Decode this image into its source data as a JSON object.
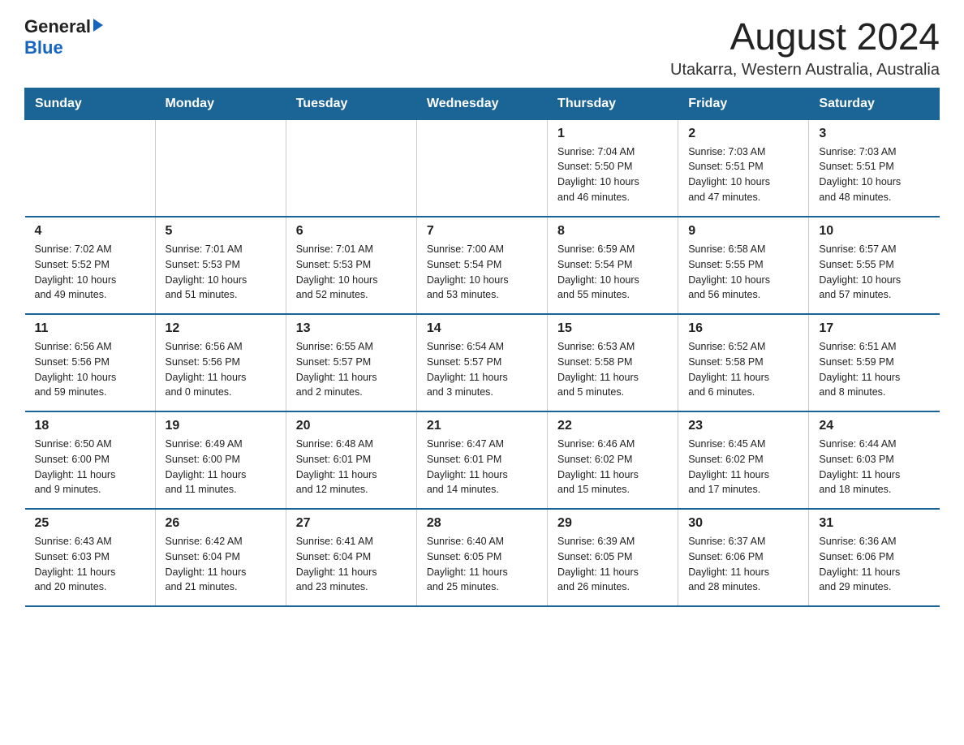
{
  "logo": {
    "general": "General",
    "blue": "Blue"
  },
  "title": "August 2024",
  "subtitle": "Utakarra, Western Australia, Australia",
  "days_of_week": [
    "Sunday",
    "Monday",
    "Tuesday",
    "Wednesday",
    "Thursday",
    "Friday",
    "Saturday"
  ],
  "weeks": [
    {
      "days": [
        {
          "number": "",
          "info": ""
        },
        {
          "number": "",
          "info": ""
        },
        {
          "number": "",
          "info": ""
        },
        {
          "number": "",
          "info": ""
        },
        {
          "number": "1",
          "info": "Sunrise: 7:04 AM\nSunset: 5:50 PM\nDaylight: 10 hours\nand 46 minutes."
        },
        {
          "number": "2",
          "info": "Sunrise: 7:03 AM\nSunset: 5:51 PM\nDaylight: 10 hours\nand 47 minutes."
        },
        {
          "number": "3",
          "info": "Sunrise: 7:03 AM\nSunset: 5:51 PM\nDaylight: 10 hours\nand 48 minutes."
        }
      ]
    },
    {
      "days": [
        {
          "number": "4",
          "info": "Sunrise: 7:02 AM\nSunset: 5:52 PM\nDaylight: 10 hours\nand 49 minutes."
        },
        {
          "number": "5",
          "info": "Sunrise: 7:01 AM\nSunset: 5:53 PM\nDaylight: 10 hours\nand 51 minutes."
        },
        {
          "number": "6",
          "info": "Sunrise: 7:01 AM\nSunset: 5:53 PM\nDaylight: 10 hours\nand 52 minutes."
        },
        {
          "number": "7",
          "info": "Sunrise: 7:00 AM\nSunset: 5:54 PM\nDaylight: 10 hours\nand 53 minutes."
        },
        {
          "number": "8",
          "info": "Sunrise: 6:59 AM\nSunset: 5:54 PM\nDaylight: 10 hours\nand 55 minutes."
        },
        {
          "number": "9",
          "info": "Sunrise: 6:58 AM\nSunset: 5:55 PM\nDaylight: 10 hours\nand 56 minutes."
        },
        {
          "number": "10",
          "info": "Sunrise: 6:57 AM\nSunset: 5:55 PM\nDaylight: 10 hours\nand 57 minutes."
        }
      ]
    },
    {
      "days": [
        {
          "number": "11",
          "info": "Sunrise: 6:56 AM\nSunset: 5:56 PM\nDaylight: 10 hours\nand 59 minutes."
        },
        {
          "number": "12",
          "info": "Sunrise: 6:56 AM\nSunset: 5:56 PM\nDaylight: 11 hours\nand 0 minutes."
        },
        {
          "number": "13",
          "info": "Sunrise: 6:55 AM\nSunset: 5:57 PM\nDaylight: 11 hours\nand 2 minutes."
        },
        {
          "number": "14",
          "info": "Sunrise: 6:54 AM\nSunset: 5:57 PM\nDaylight: 11 hours\nand 3 minutes."
        },
        {
          "number": "15",
          "info": "Sunrise: 6:53 AM\nSunset: 5:58 PM\nDaylight: 11 hours\nand 5 minutes."
        },
        {
          "number": "16",
          "info": "Sunrise: 6:52 AM\nSunset: 5:58 PM\nDaylight: 11 hours\nand 6 minutes."
        },
        {
          "number": "17",
          "info": "Sunrise: 6:51 AM\nSunset: 5:59 PM\nDaylight: 11 hours\nand 8 minutes."
        }
      ]
    },
    {
      "days": [
        {
          "number": "18",
          "info": "Sunrise: 6:50 AM\nSunset: 6:00 PM\nDaylight: 11 hours\nand 9 minutes."
        },
        {
          "number": "19",
          "info": "Sunrise: 6:49 AM\nSunset: 6:00 PM\nDaylight: 11 hours\nand 11 minutes."
        },
        {
          "number": "20",
          "info": "Sunrise: 6:48 AM\nSunset: 6:01 PM\nDaylight: 11 hours\nand 12 minutes."
        },
        {
          "number": "21",
          "info": "Sunrise: 6:47 AM\nSunset: 6:01 PM\nDaylight: 11 hours\nand 14 minutes."
        },
        {
          "number": "22",
          "info": "Sunrise: 6:46 AM\nSunset: 6:02 PM\nDaylight: 11 hours\nand 15 minutes."
        },
        {
          "number": "23",
          "info": "Sunrise: 6:45 AM\nSunset: 6:02 PM\nDaylight: 11 hours\nand 17 minutes."
        },
        {
          "number": "24",
          "info": "Sunrise: 6:44 AM\nSunset: 6:03 PM\nDaylight: 11 hours\nand 18 minutes."
        }
      ]
    },
    {
      "days": [
        {
          "number": "25",
          "info": "Sunrise: 6:43 AM\nSunset: 6:03 PM\nDaylight: 11 hours\nand 20 minutes."
        },
        {
          "number": "26",
          "info": "Sunrise: 6:42 AM\nSunset: 6:04 PM\nDaylight: 11 hours\nand 21 minutes."
        },
        {
          "number": "27",
          "info": "Sunrise: 6:41 AM\nSunset: 6:04 PM\nDaylight: 11 hours\nand 23 minutes."
        },
        {
          "number": "28",
          "info": "Sunrise: 6:40 AM\nSunset: 6:05 PM\nDaylight: 11 hours\nand 25 minutes."
        },
        {
          "number": "29",
          "info": "Sunrise: 6:39 AM\nSunset: 6:05 PM\nDaylight: 11 hours\nand 26 minutes."
        },
        {
          "number": "30",
          "info": "Sunrise: 6:37 AM\nSunset: 6:06 PM\nDaylight: 11 hours\nand 28 minutes."
        },
        {
          "number": "31",
          "info": "Sunrise: 6:36 AM\nSunset: 6:06 PM\nDaylight: 11 hours\nand 29 minutes."
        }
      ]
    }
  ]
}
